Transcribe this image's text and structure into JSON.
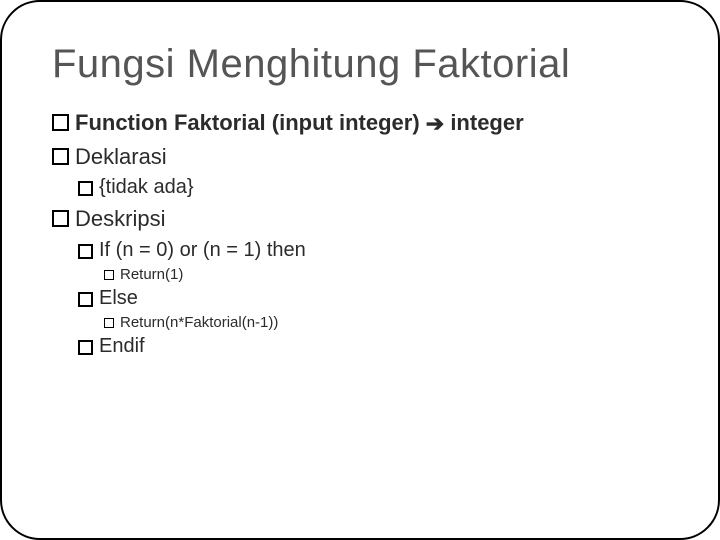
{
  "title": "Fungsi Menghitung Faktorial",
  "line1": {
    "prefix": "Function Faktorial (input integer) ",
    "arrow": "➔",
    "suffix": " integer"
  },
  "deklarasi": {
    "label": "Deklarasi",
    "content": "{tidak ada}"
  },
  "deskripsi": {
    "label": "Deskripsi",
    "if_line": "If (n = 0) or (n = 1) then",
    "return1": "Return(1)",
    "else_line": "Else",
    "return2": "Return(n*Faktorial(n-1))",
    "endif": "Endif"
  }
}
